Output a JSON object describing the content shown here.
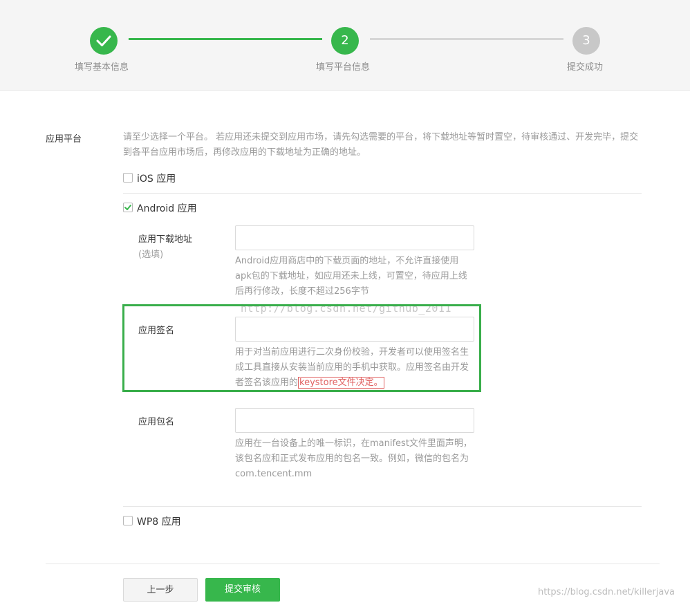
{
  "stepper": {
    "steps": [
      {
        "label": "填写基本信息",
        "number": "",
        "state": "done"
      },
      {
        "label": "填写平台信息",
        "number": "2",
        "state": "active"
      },
      {
        "label": "提交成功",
        "number": "3",
        "state": "pending"
      }
    ]
  },
  "platform": {
    "label": "应用平台",
    "hint": "请至少选择一个平台。 若应用还未提交到应用市场，请先勾选需要的平台，将下载地址等暂时置空，待审核通过、开发完毕，提交到各平台应用市场后，再修改应用的下载地址为正确的地址。"
  },
  "options": {
    "ios": {
      "label": "iOS 应用",
      "checked": false
    },
    "android": {
      "label": "Android 应用",
      "checked": true
    },
    "wp8": {
      "label": "WP8 应用",
      "checked": false
    }
  },
  "android_fields": {
    "download": {
      "label": "应用下载地址",
      "sublabel": "(选填)",
      "value": "",
      "hint": "Android应用商店中的下载页面的地址，不允许直接使用apk包的下载地址，如应用还未上线，可置空，待应用上线后再行修改，长度不超过256字节"
    },
    "signature": {
      "label": "应用签名",
      "value": "",
      "hint": "用于对当前应用进行二次身份校验，开发者可以使用签名生成工具直接从安装当前应用的手机中获取。应用签名由开发者签名该应用的",
      "hint_highlight": "keystore文件决定。"
    },
    "package": {
      "label": "应用包名",
      "value": "",
      "hint": "应用在一台设备上的唯一标识，在manifest文件里面声明，该包名应和正式发布应用的包名一致。例如，微信的包名为com.tencent.mm"
    }
  },
  "buttons": {
    "prev": "上一步",
    "submit": "提交审核"
  },
  "watermarks": {
    "center": "http://blog.csdn.net/github_2011",
    "corner": "https://blog.csdn.net/killerjava"
  },
  "colors": {
    "accent": "#37b74c",
    "annotation_box": "#39ae4b",
    "annotation_underline": "#e06060"
  }
}
